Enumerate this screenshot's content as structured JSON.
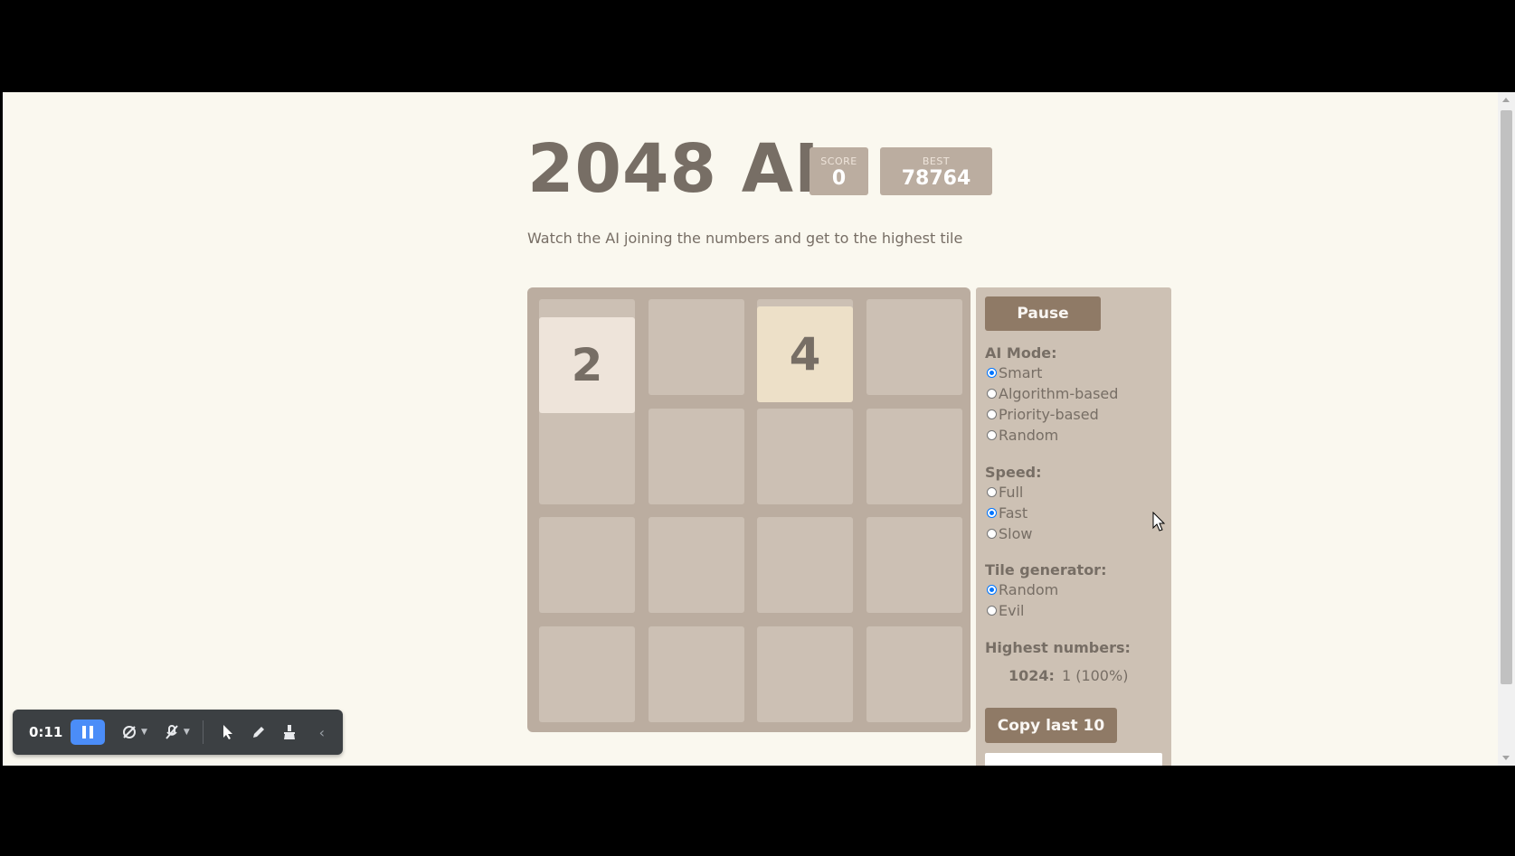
{
  "header": {
    "title": "2048 AI",
    "score_label": "SCORE",
    "score_value": "0",
    "best_label": "BEST",
    "best_value": "78764",
    "intro": "Watch the AI joining the numbers and get to the highest tile"
  },
  "board": {
    "tiles": [
      {
        "row": 0,
        "col": 0,
        "value": "2",
        "color": "#eee4da"
      },
      {
        "row": 0,
        "col": 2,
        "value": "4",
        "color": "#ede0c8"
      }
    ]
  },
  "panel": {
    "pause_label": "Pause",
    "ai_mode": {
      "title": "AI Mode:",
      "options": [
        "Smart",
        "Algorithm-based",
        "Priority-based",
        "Random"
      ],
      "selected": "Smart"
    },
    "speed": {
      "title": "Speed:",
      "options": [
        "Full",
        "Fast",
        "Slow"
      ],
      "selected": "Fast"
    },
    "tile_generator": {
      "title": "Tile generator:",
      "options": [
        "Random",
        "Evil"
      ],
      "selected": "Random"
    },
    "highest_numbers": {
      "title": "Highest numbers:",
      "number": "1024:",
      "count": "1 (100%)"
    },
    "copy_label": "Copy last 10"
  },
  "recorder": {
    "time": "0:11",
    "icons": [
      "pause-icon",
      "camera-off-icon",
      "mic-off-icon",
      "pointer-icon",
      "pen-icon",
      "eraser-icon",
      "collapse-icon"
    ]
  },
  "colors": {
    "background": "#faf8ef",
    "board": "#bbada0",
    "panel": "#cdc1b4",
    "button": "#8f7a66",
    "text": "#776e65",
    "radio_accent": "#0075ff"
  }
}
